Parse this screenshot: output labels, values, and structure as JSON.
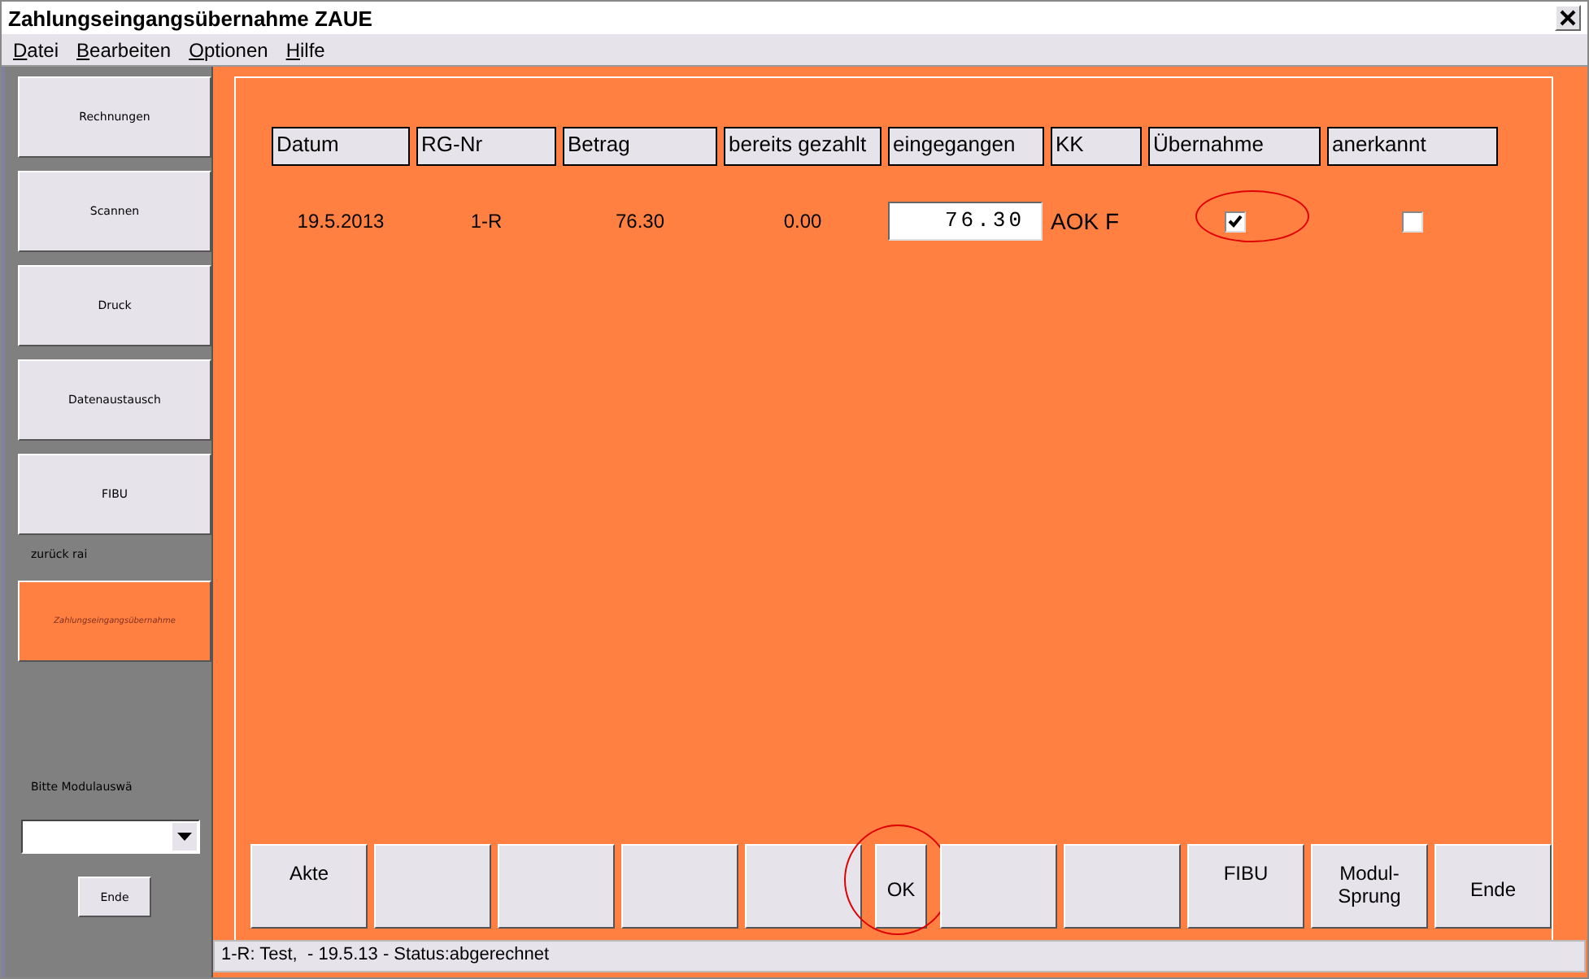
{
  "window": {
    "title": "Zahlungseingangsübernahme ZAUE"
  },
  "menu": [
    "Datei",
    "Bearbeiten",
    "Optionen",
    "Hilfe"
  ],
  "sidebar": {
    "items": [
      {
        "kind": "button",
        "label": "Rechnungen",
        "selected": false
      },
      {
        "kind": "button",
        "label": "Scannen",
        "selected": false
      },
      {
        "kind": "button",
        "label": "Druck",
        "selected": false
      },
      {
        "kind": "button",
        "label": "Datenaustausch",
        "selected": false
      },
      {
        "kind": "button",
        "label": "FIBU",
        "selected": false
      },
      {
        "kind": "label",
        "label": "zurück rai"
      },
      {
        "kind": "button",
        "label": "Zahlungseingangsübernahme",
        "selected": true
      }
    ],
    "prompt": "Bitte Modulauswä",
    "exit_button": "Ende"
  },
  "table": {
    "columns": [
      "Datum",
      "RG-Nr",
      "Betrag",
      "bereits gezahlt",
      "eingegangen",
      "KK",
      "Übernahme",
      "anerkannt"
    ],
    "rows": [
      [
        {
          "kind": "text",
          "value": "19.5.2013"
        },
        {
          "kind": "text",
          "value": "1-R"
        },
        {
          "kind": "text",
          "value": "76.30"
        },
        {
          "kind": "text",
          "value": "0.00"
        },
        {
          "kind": "input",
          "value": "76.30"
        },
        {
          "kind": "text",
          "value": "AOK F"
        },
        {
          "kind": "checkbox",
          "checked": true,
          "circled": true
        },
        {
          "kind": "checkbox",
          "checked": false,
          "circled": false
        }
      ]
    ]
  },
  "buttons": [
    {
      "kind": "normal",
      "label": "Akte",
      "circled": false
    },
    {
      "kind": "normal",
      "circled": false
    },
    {
      "kind": "normal",
      "circled": false
    },
    {
      "kind": "normal",
      "circled": false
    },
    {
      "kind": "normal",
      "circled": false
    },
    {
      "kind": "narrow",
      "label": "OK",
      "circled": true
    },
    {
      "kind": "normal",
      "circled": false
    },
    {
      "kind": "normal",
      "circled": false
    },
    {
      "kind": "normal",
      "label": "FIBU",
      "circled": false
    },
    {
      "kind": "normal",
      "label": "Modul-\nSprung",
      "circled": false
    },
    {
      "kind": "normal",
      "label": "Ende",
      "circled": false
    }
  ],
  "status_bar": "1-R: Test,  - 19.5.13 - Status:abgerechnet"
}
